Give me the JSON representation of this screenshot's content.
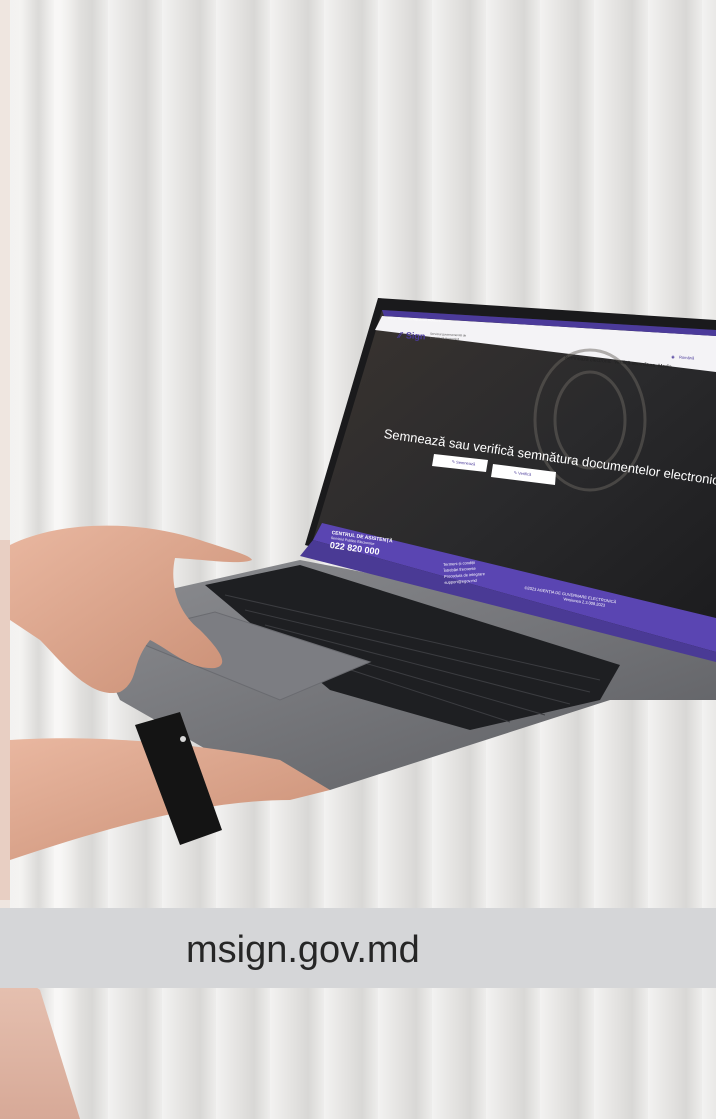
{
  "caption": {
    "text": "msign.gov.md"
  },
  "site": {
    "top_bar_text": "MSign  Guvernul Republicii Moldova",
    "logo_word": "Sign",
    "logo_tagline": "Serviciul guvernamental de semnătură electronică",
    "lang": "Română",
    "nav": [
      "Semnează electronic",
      "Verifică semnătura",
      "Media"
    ],
    "hero_title": "Semnează sau verifică semnătura documentelor electronice",
    "btn_sign": "Semnează",
    "btn_verify": "Verifică",
    "footer": {
      "center_title": "CENTRUL DE ASISTENȚĂ",
      "center_sub": "Serviciul Publice Electronice",
      "phone": "022 820 000",
      "links": [
        "Termeni și condiții",
        "Întrebări frecvente",
        "Procedura de integrare",
        "support@egov.md"
      ],
      "copyright": "©2023 AGENȚIA DE GUVERNARE ELECTRONICĂ",
      "version": "Versiunea 2.3.009.2023"
    }
  },
  "colors": {
    "accent": "#4b3a9a",
    "footer": "#5a45b2",
    "caption_band": "#d5d6d8"
  }
}
